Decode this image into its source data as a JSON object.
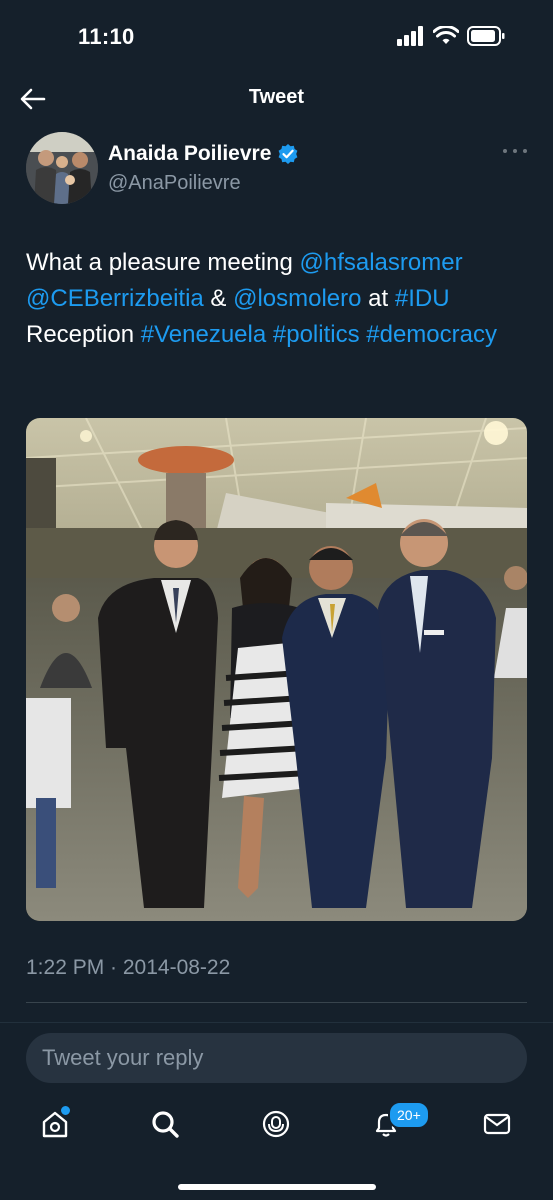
{
  "status_bar": {
    "time": "11:10"
  },
  "nav": {
    "title": "Tweet"
  },
  "author": {
    "display_name": "Anaida Poilievre",
    "handle": "@AnaPoilievre",
    "verified": true
  },
  "tweet": {
    "segments": [
      {
        "text": "What a pleasure meeting ",
        "type": "text"
      },
      {
        "text": "@hfsalasromer",
        "type": "mention"
      },
      {
        "text": " ",
        "type": "text"
      },
      {
        "text": "@CEBerrizbeitia",
        "type": "mention"
      },
      {
        "text": " & ",
        "type": "text"
      },
      {
        "text": "@losmolero",
        "type": "mention"
      },
      {
        "text": " at ",
        "type": "text"
      },
      {
        "text": "#IDU",
        "type": "hashtag"
      },
      {
        "text": " Reception ",
        "type": "text"
      },
      {
        "text": "#Venezuela",
        "type": "hashtag"
      },
      {
        "text": " ",
        "type": "text"
      },
      {
        "text": "#politics",
        "type": "hashtag"
      },
      {
        "text": " ",
        "type": "text"
      },
      {
        "text": "#democracy",
        "type": "hashtag"
      }
    ],
    "timestamp": "1:22 PM · 2014-08-22"
  },
  "reply": {
    "placeholder": "Tweet your reply"
  },
  "tabbar": {
    "items": [
      {
        "name": "home",
        "icon": "home-icon",
        "dot": true
      },
      {
        "name": "search",
        "icon": "search-icon"
      },
      {
        "name": "spaces",
        "icon": "spaces-icon"
      },
      {
        "name": "notifications",
        "icon": "bell-icon",
        "badge": "20+"
      },
      {
        "name": "messages",
        "icon": "mail-icon"
      }
    ]
  },
  "colors": {
    "background": "#15202b",
    "accent": "#1d9bf0",
    "muted": "#8b98a5"
  }
}
